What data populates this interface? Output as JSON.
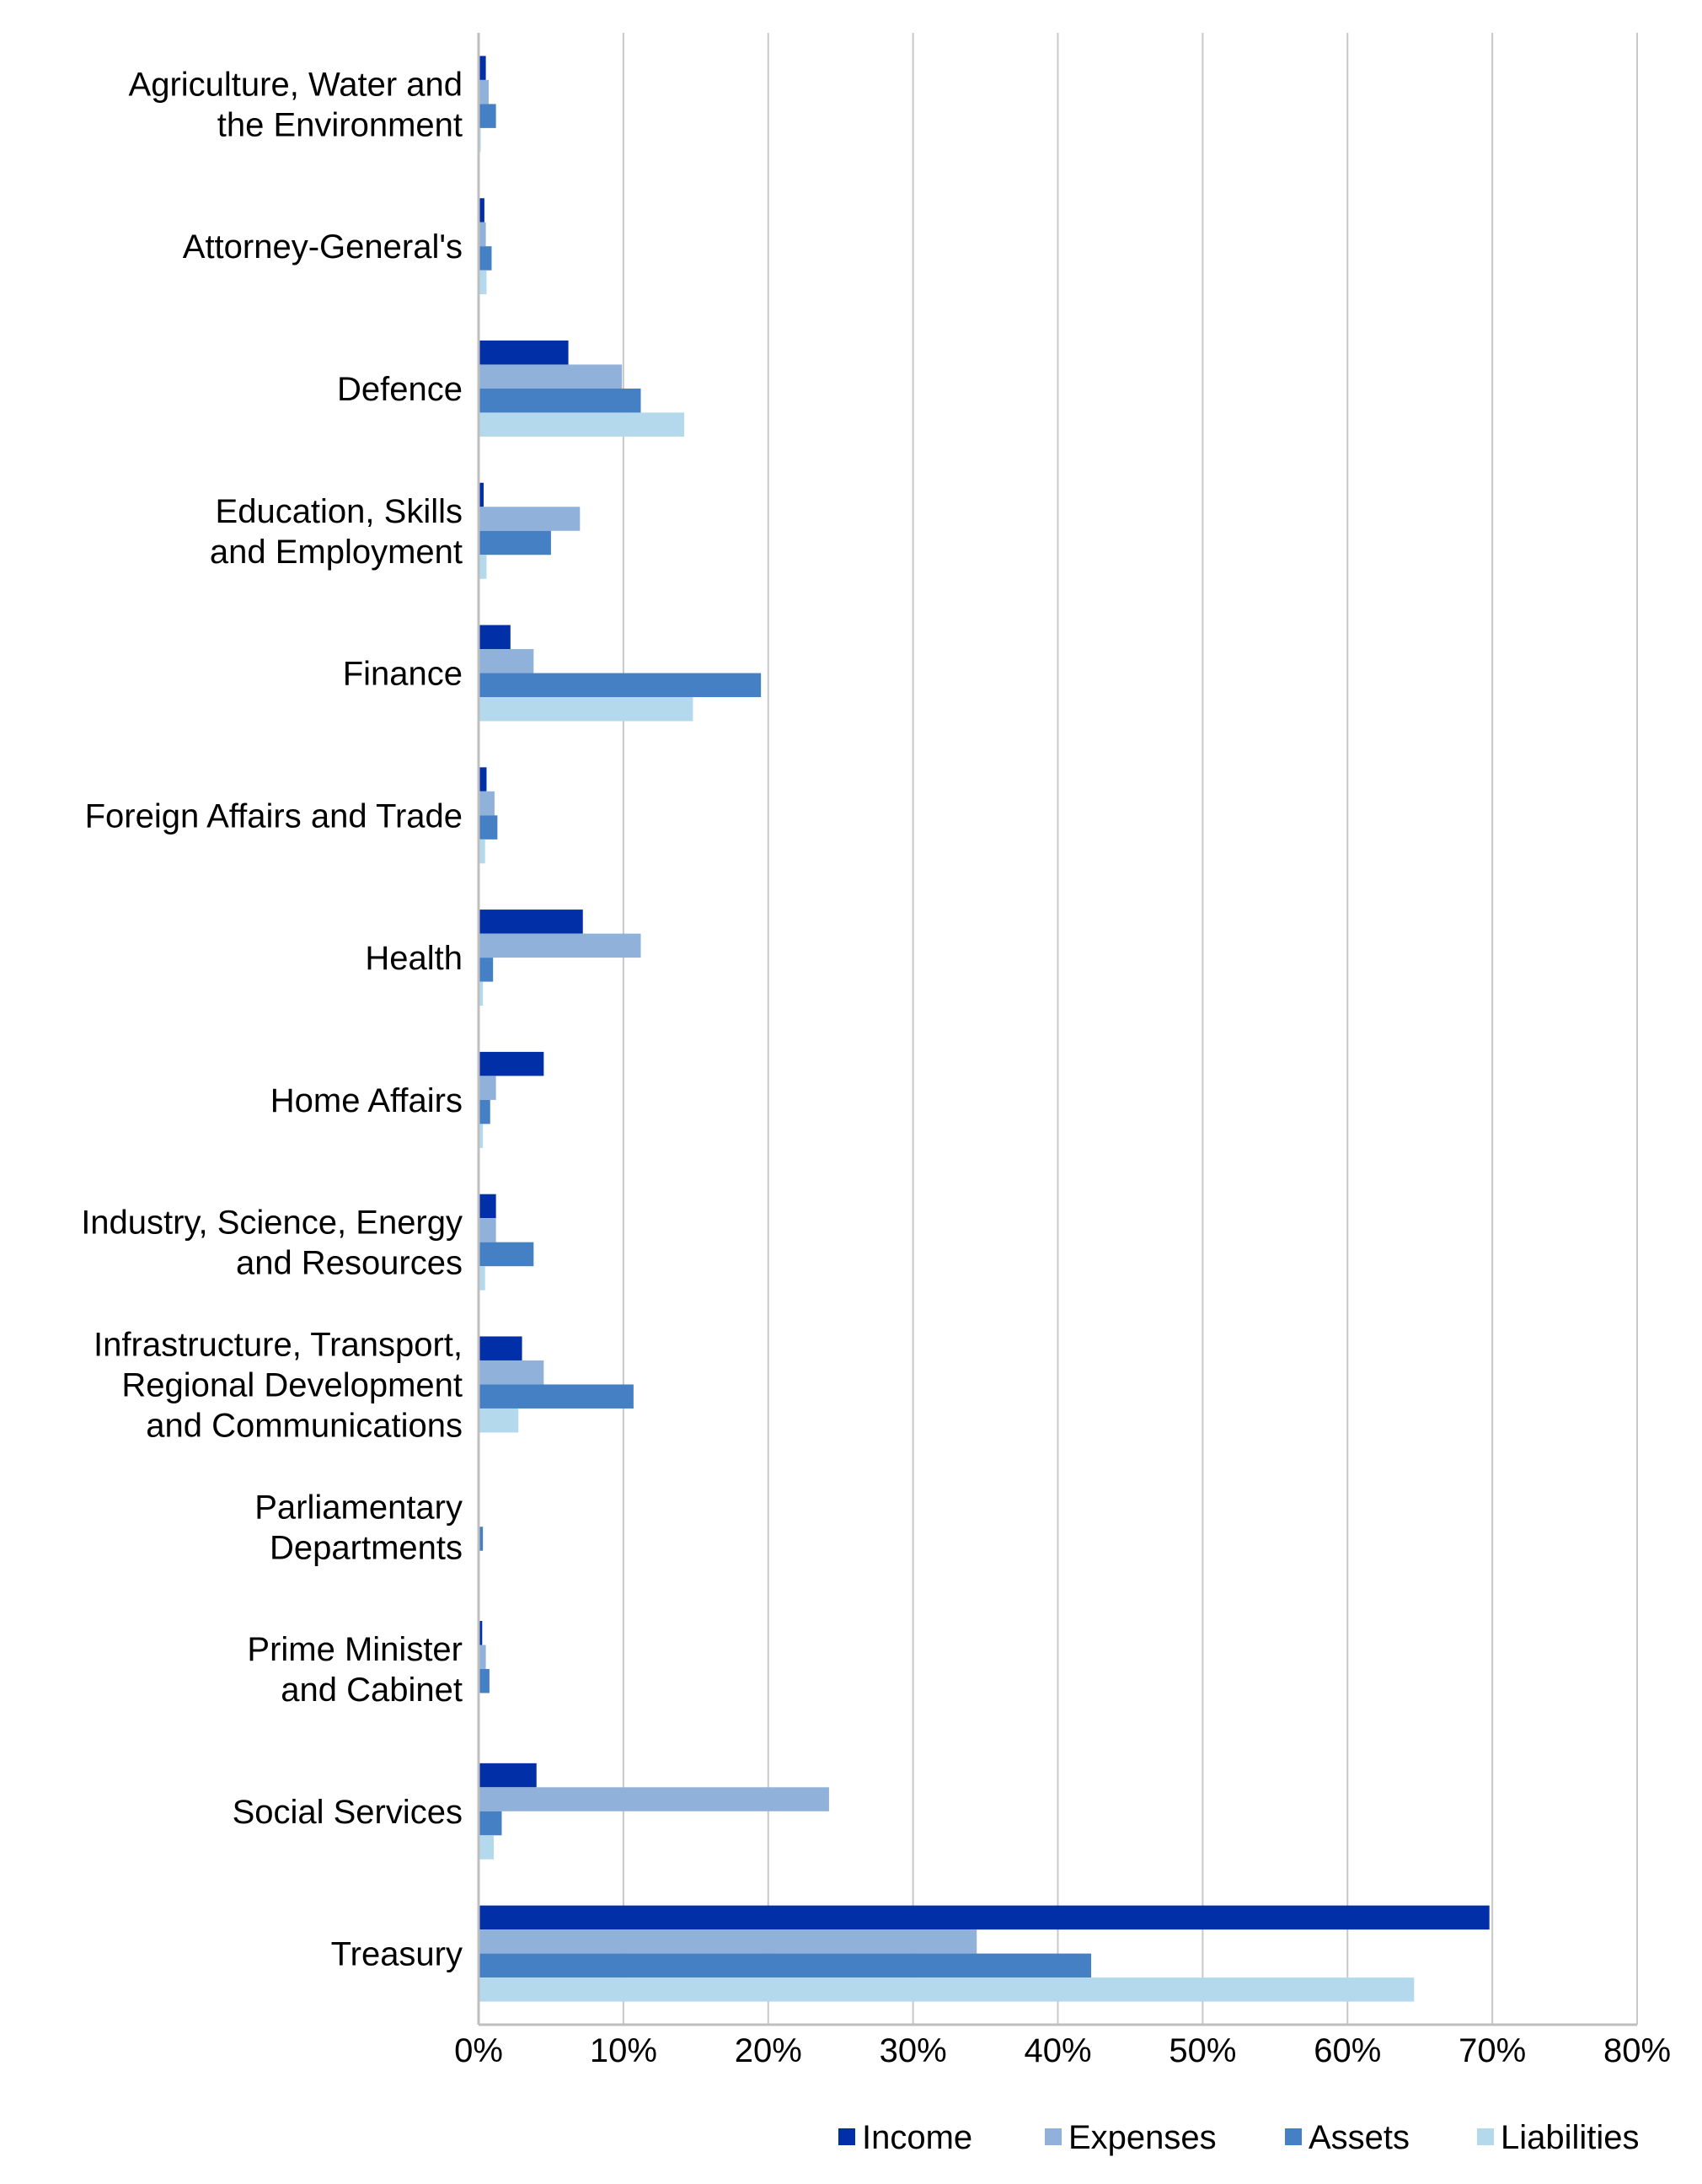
{
  "chart_data": {
    "type": "bar",
    "orientation": "horizontal",
    "title": "",
    "xlabel": "",
    "ylabel": "",
    "xlim": [
      0,
      80
    ],
    "x_ticks": [
      "0%",
      "10%",
      "20%",
      "30%",
      "40%",
      "50%",
      "60%",
      "70%",
      "80%"
    ],
    "x_tick_values": [
      0,
      10,
      20,
      30,
      40,
      50,
      60,
      70,
      80
    ],
    "value_unit": "%",
    "grid": "vertical",
    "legend_position": "bottom-right",
    "categories": [
      [
        "Agriculture, Water and",
        "the Environment"
      ],
      [
        "Attorney-General's"
      ],
      [
        "Defence"
      ],
      [
        "Education, Skills",
        "and Employment"
      ],
      [
        "Finance"
      ],
      [
        "Foreign Affairs and Trade"
      ],
      [
        "Health"
      ],
      [
        "Home Affairs"
      ],
      [
        "Industry, Science, Energy",
        "and Resources"
      ],
      [
        "Infrastructure, Transport,",
        "Regional Development",
        "and Communications"
      ],
      [
        "Parliamentary",
        "Departments"
      ],
      [
        "Prime Minister",
        "and Cabinet"
      ],
      [
        "Social Services"
      ],
      [
        "Treasury"
      ]
    ],
    "series": [
      {
        "name": "Income",
        "color": "#002FA7",
        "values": [
          0.5,
          0.4,
          6.2,
          0.35,
          2.2,
          0.55,
          7.2,
          4.5,
          1.2,
          3.0,
          0.0,
          0.25,
          4.0,
          69.8
        ]
      },
      {
        "name": "Expenses",
        "color": "#8FB1DA",
        "values": [
          0.7,
          0.5,
          9.9,
          7.0,
          3.8,
          1.1,
          11.2,
          1.2,
          1.2,
          4.5,
          0.0,
          0.5,
          24.2,
          34.4
        ]
      },
      {
        "name": "Assets",
        "color": "#4580C4",
        "values": [
          1.2,
          0.9,
          11.2,
          5.0,
          19.5,
          1.3,
          1.0,
          0.8,
          3.8,
          10.7,
          0.3,
          0.75,
          1.6,
          42.3
        ]
      },
      {
        "name": "Liabilities",
        "color": "#B4D9EC",
        "values": [
          0.15,
          0.55,
          14.2,
          0.55,
          14.8,
          0.45,
          0.3,
          0.3,
          0.45,
          2.75,
          0.0,
          0.05,
          1.05,
          64.6
        ]
      }
    ]
  },
  "colors": {
    "gridline": "#C8C8C8",
    "axis": "#BFBFBF",
    "text": "#000000"
  }
}
